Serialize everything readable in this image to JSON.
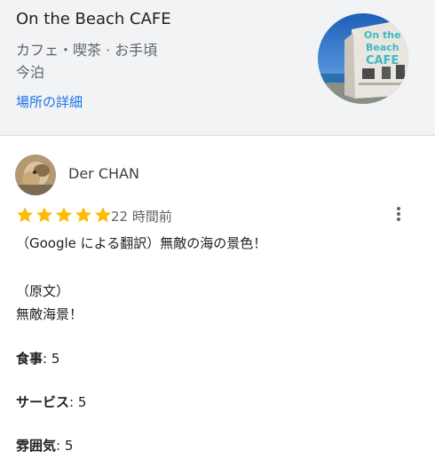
{
  "place": {
    "name": "On the Beach CAFE",
    "category": "カフェ・喫茶 · お手頃",
    "location": "今泊",
    "details_link": "場所の詳細",
    "thumbnail_sign": [
      "On the",
      "Beach",
      "CAFE"
    ]
  },
  "review": {
    "author": "Der CHAN",
    "rating": 5,
    "max_rating": 5,
    "time_ago": "22 時間前",
    "translated_text": "（Google による翻訳）無敵の海の景色！",
    "original_label": "（原文）",
    "original_text": "無敵海景！",
    "attributes": [
      {
        "label": "食事",
        "value": ": 5"
      },
      {
        "label": "サービス",
        "value": ": 5"
      },
      {
        "label": "雰囲気",
        "value": ": 5"
      }
    ]
  },
  "colors": {
    "star": "#fbbc04",
    "link": "#1a73e8",
    "header_bg": "#f1f3f4"
  },
  "icons": {
    "more": "more-vert-icon",
    "star": "star-icon"
  }
}
